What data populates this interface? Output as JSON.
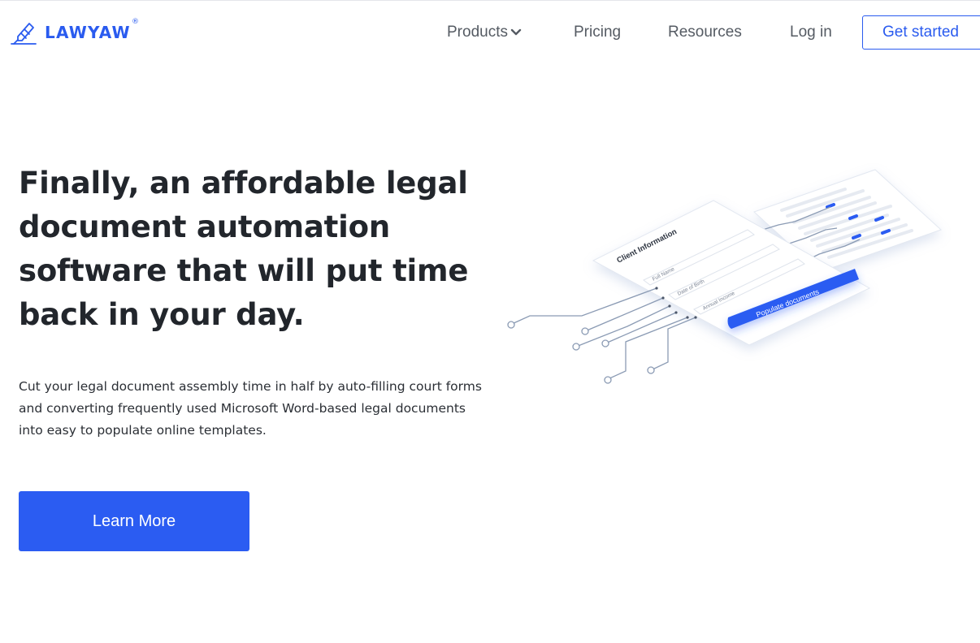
{
  "brand": {
    "name": "LAWYAW",
    "registered": "®",
    "accent_color": "#2a5bef"
  },
  "nav": {
    "products": "Products",
    "pricing": "Pricing",
    "resources": "Resources",
    "login": "Log in",
    "get_started": "Get started"
  },
  "hero": {
    "headline": "Finally, an affordable legal document automation software that will put time back in your day.",
    "subtext": "Cut your legal document assembly time in half by auto-filling court forms and converting frequently used Microsoft Word-based legal documents into easy to populate online templates.",
    "cta_label": "Learn More",
    "cta_color": "#2b5cf2"
  },
  "illustration": {
    "form_title": "Client Information",
    "fields": [
      "Full Name",
      "Date of Birth",
      "Annual Income"
    ],
    "button_label": "Populate documents"
  }
}
